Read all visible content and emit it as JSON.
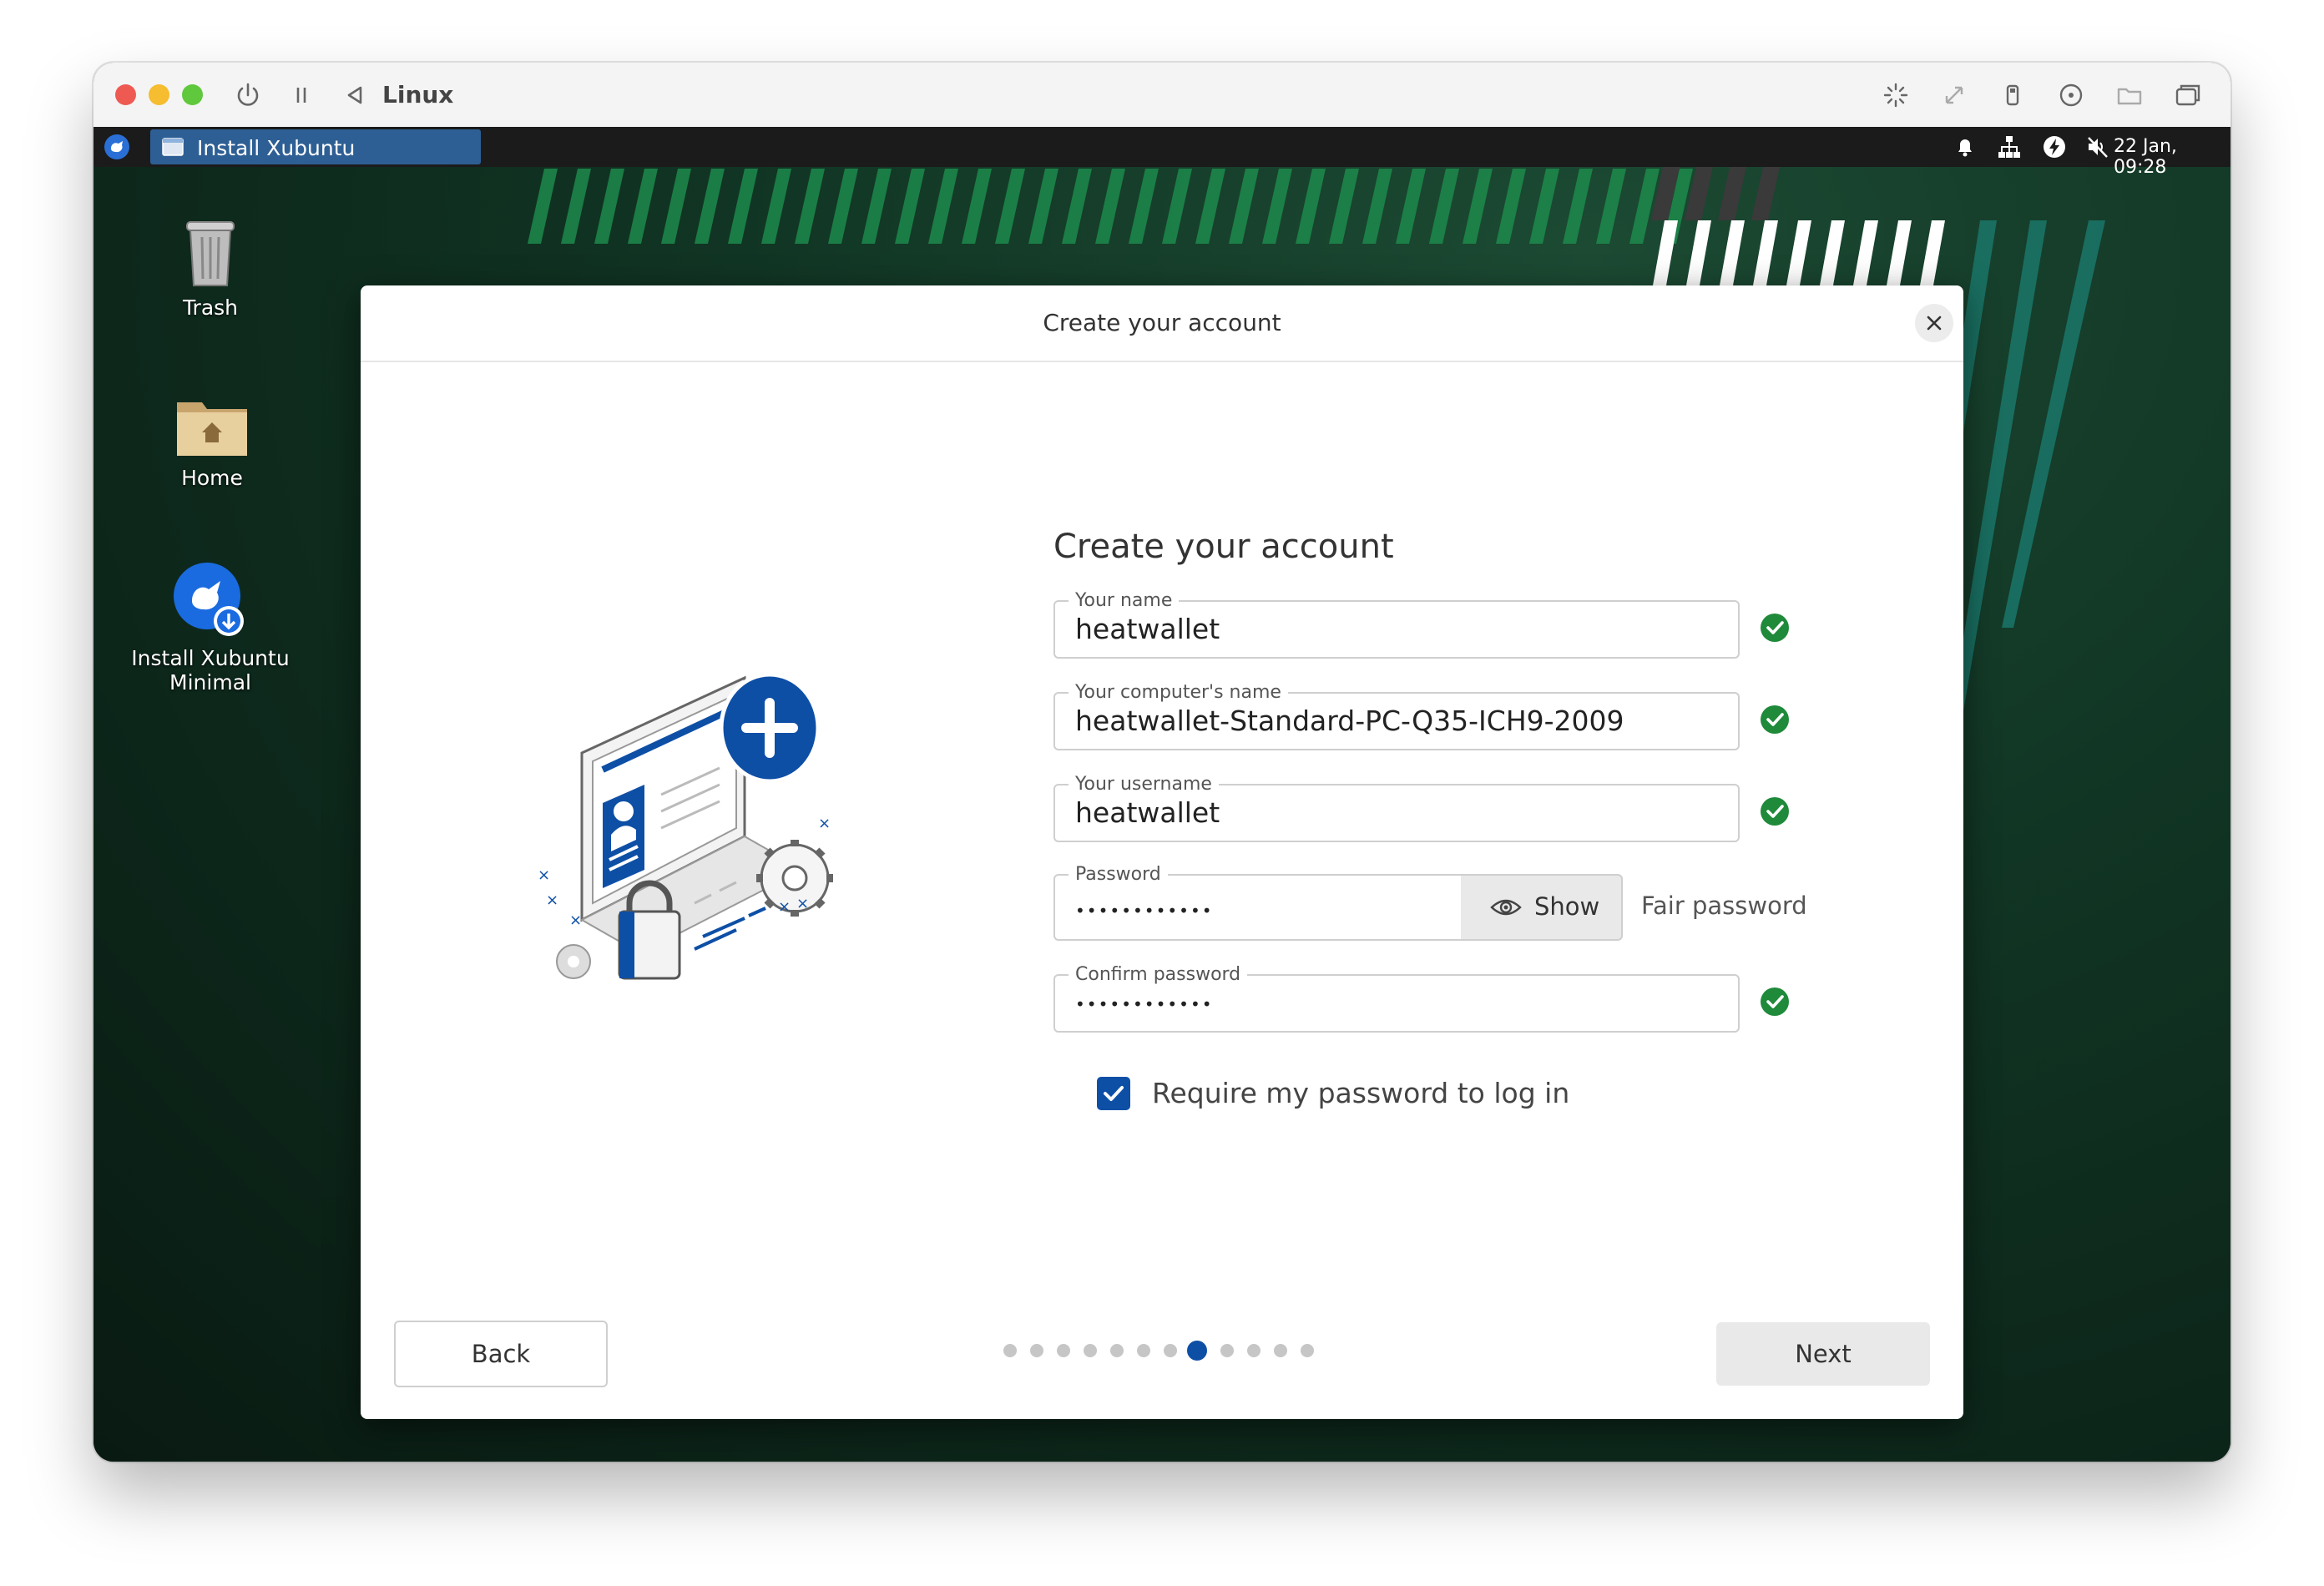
{
  "vm": {
    "title": "Linux"
  },
  "taskbar": {
    "task_label": "Install Xubuntu",
    "clock": "22 Jan, 09:28"
  },
  "desktop": {
    "icons": [
      {
        "label": "Trash"
      },
      {
        "label": "Home"
      },
      {
        "label_line1": "Install Xubuntu",
        "label_line2": "Minimal"
      }
    ]
  },
  "dialog": {
    "window_title": "Create your account",
    "heading": "Create your account",
    "fields": {
      "name": {
        "label": "Your name",
        "value": "heatwallet"
      },
      "computer": {
        "label": "Your computer's name",
        "value": "heatwallet-Standard-PC-Q35-ICH9-2009"
      },
      "username": {
        "label": "Your username",
        "value": "heatwallet"
      },
      "password": {
        "label": "Password",
        "value": "••••••••••••"
      },
      "confirm": {
        "label": "Confirm password",
        "value": "••••••••••••"
      }
    },
    "show_label": "Show",
    "strength": "Fair password",
    "require_password": {
      "label": "Require my password to log in",
      "checked": true
    },
    "back_label": "Back",
    "next_label": "Next",
    "steps": {
      "total": 12,
      "current": 8
    }
  },
  "colors": {
    "accent": "#0e4fa6",
    "success": "#1f8a3a"
  }
}
